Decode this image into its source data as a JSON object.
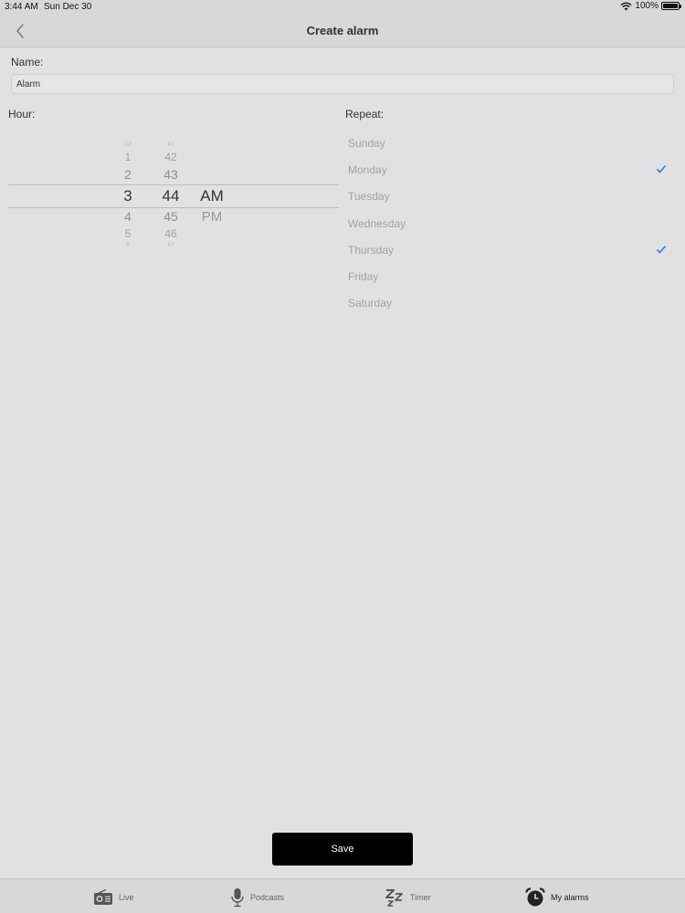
{
  "status_bar": {
    "time": "3:44 AM",
    "date": "Sun Dec 30",
    "battery": "100%"
  },
  "nav": {
    "title": "Create alarm"
  },
  "name": {
    "label": "Name:",
    "value": "Alarm"
  },
  "hour": {
    "label": "Hour:",
    "hours": {
      "far_top": "12",
      "near2_top": "1",
      "near1_top": "2",
      "selected": "3",
      "near1_bottom": "4",
      "near2_bottom": "5",
      "far_bottom": "6"
    },
    "minutes": {
      "far_top": "41",
      "near2_top": "42",
      "near1_top": "43",
      "selected": "44",
      "near1_bottom": "45",
      "near2_bottom": "46",
      "far_bottom": "47"
    },
    "ampm": {
      "selected": "AM",
      "other": "PM"
    }
  },
  "repeat": {
    "label": "Repeat:",
    "days": [
      {
        "name": "Sunday",
        "checked": false
      },
      {
        "name": "Monday",
        "checked": true
      },
      {
        "name": "Tuesday",
        "checked": false
      },
      {
        "name": "Wednesday",
        "checked": false
      },
      {
        "name": "Thursday",
        "checked": true
      },
      {
        "name": "Friday",
        "checked": false
      },
      {
        "name": "Saturday",
        "checked": false
      }
    ],
    "check_color": "#2f7fd6"
  },
  "save": {
    "label": "Save"
  },
  "tabs": [
    {
      "label": "Live",
      "icon": "radio-icon",
      "active": false
    },
    {
      "label": "Podcasts",
      "icon": "microphone-icon",
      "active": false
    },
    {
      "label": "Timer",
      "icon": "sleep-zzz-icon",
      "active": false
    },
    {
      "label": "My alarms",
      "icon": "alarm-clock-icon",
      "active": true
    }
  ]
}
